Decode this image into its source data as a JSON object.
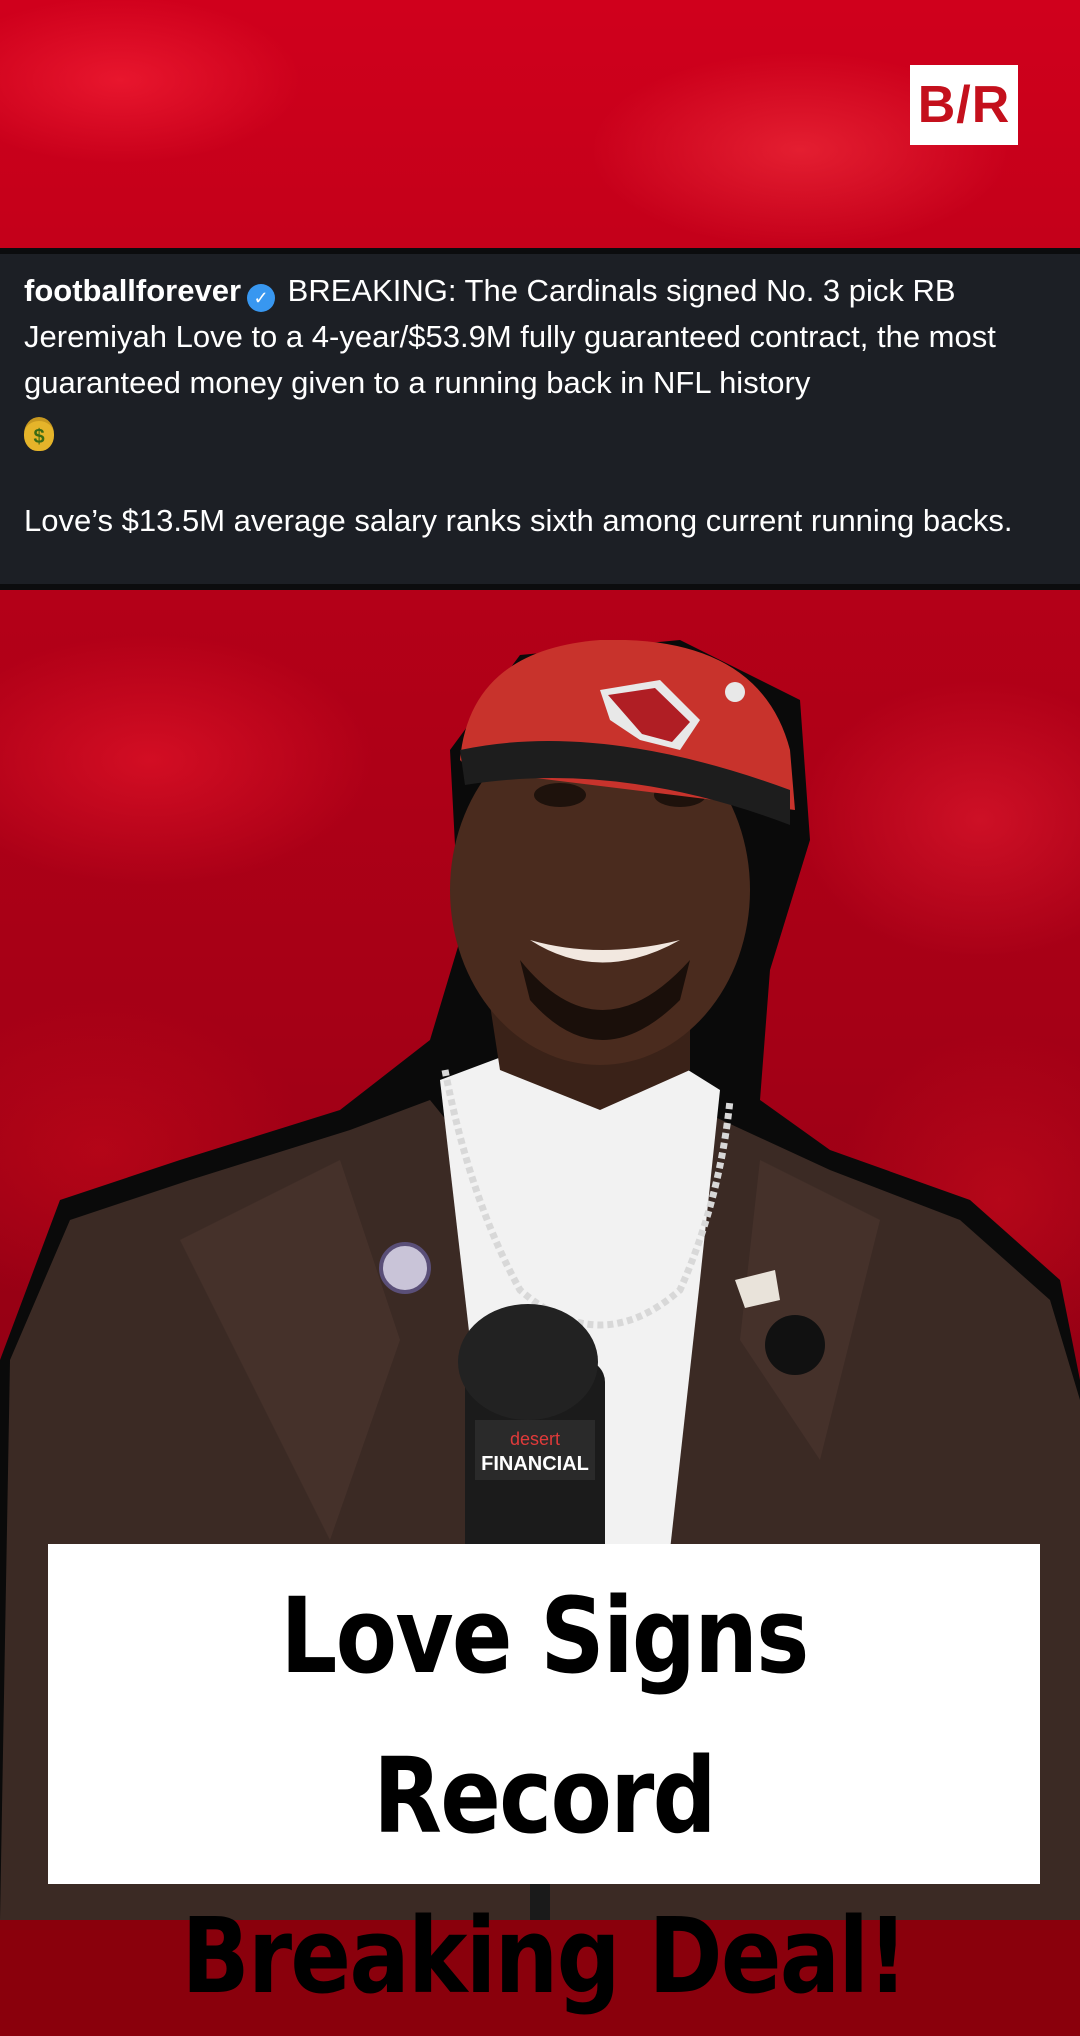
{
  "brand": {
    "logo_text": "B/R"
  },
  "post": {
    "username": "footballforever",
    "verified_icon": "verified-badge-icon",
    "text_main": "BREAKING: The Cardinals signed No. 3 pick RB Jeremiyah Love to a 4-year/$53.9M fully guaranteed contract, the most guaranteed money given to a running back in NFL history",
    "emoji": "money-bag-icon",
    "text_second": "Love’s $13.5M average salary ranks sixth among current running backs."
  },
  "photo": {
    "mic_brand_line1": "desert",
    "mic_brand_line2": "FINANCIAL"
  },
  "headline": {
    "line1": "Love Signs Record",
    "line2": "Breaking Deal!"
  },
  "colors": {
    "background_red": "#c4001a",
    "post_background": "#1c1f25",
    "verified_blue": "#3897f0",
    "cap_red": "#c8332c"
  }
}
